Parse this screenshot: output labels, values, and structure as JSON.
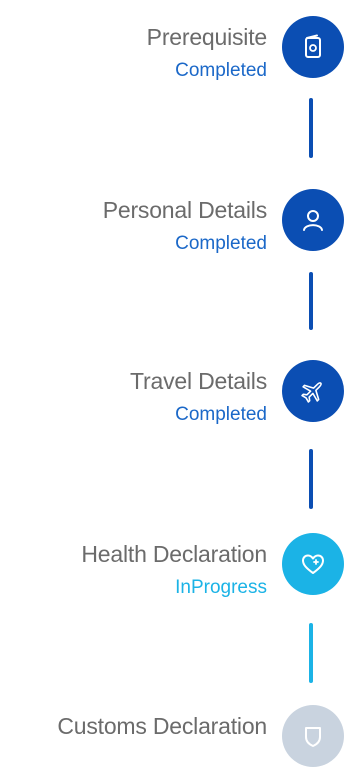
{
  "colors": {
    "completed": "#0b4eb3",
    "in_progress": "#1bb3e6",
    "pending": "#c9d3df",
    "title_text": "#6b6b6b"
  },
  "steps": [
    {
      "title": "Prerequisite",
      "status": "Completed",
      "state": "completed",
      "icon": "passport-icon"
    },
    {
      "title": "Personal Details",
      "status": "Completed",
      "state": "completed",
      "icon": "user-icon"
    },
    {
      "title": "Travel Details",
      "status": "Completed",
      "state": "completed",
      "icon": "airplane-icon"
    },
    {
      "title": "Health Declaration",
      "status": "InProgress",
      "state": "in_progress",
      "icon": "heart-plus-icon"
    },
    {
      "title": "Customs Declaration",
      "status": "",
      "state": "pending",
      "icon": "shield-icon"
    }
  ]
}
